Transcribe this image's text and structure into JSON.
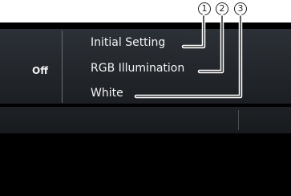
{
  "callouts": [
    "①",
    "②",
    "③"
  ],
  "panel": {
    "off_label": "Off",
    "menu_items": [
      "Initial Setting",
      "RGB Illumination",
      "White"
    ]
  }
}
